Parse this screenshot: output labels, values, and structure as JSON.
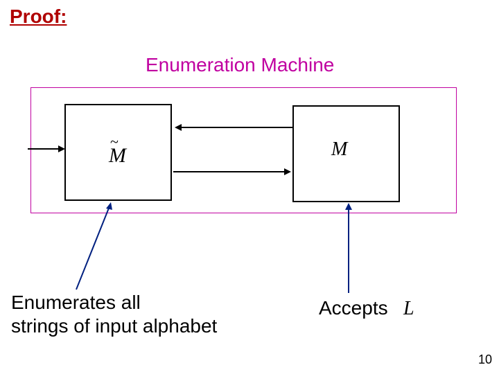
{
  "heading": "Proof:",
  "title": "Enumeration Machine",
  "machine_left": "M̃",
  "machine_right": "M",
  "caption_left_line1": "Enumerates all",
  "caption_left_line2": "strings of input alphabet",
  "caption_right": "Accepts",
  "language_symbol": "L",
  "page_number": "10"
}
